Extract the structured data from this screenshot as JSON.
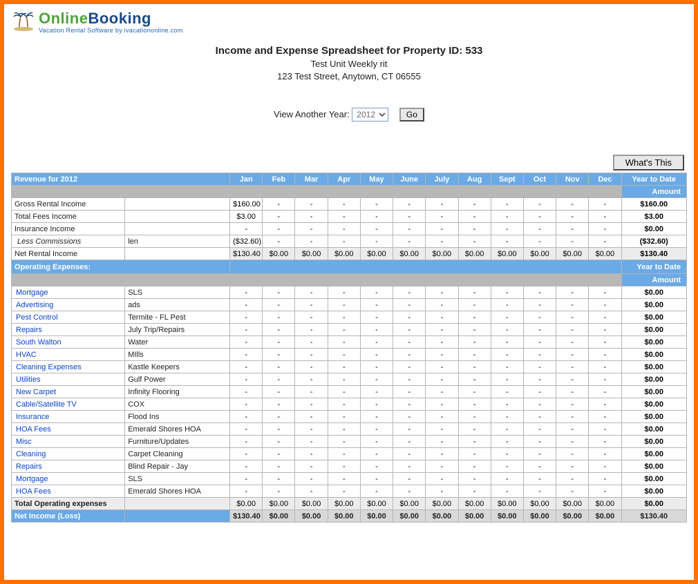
{
  "logo": {
    "line1a": "Online",
    "line1b": "Booking",
    "line2": "Vacation Rental Software by ivacationonline.com"
  },
  "header": {
    "title": "Income and Expense Spreadsheet for Property ID: 533",
    "unit": "Test Unit Weekly rit",
    "address": "123 Test Street, Anytown, CT 06555"
  },
  "controls": {
    "yearLabel": "View Another Year:",
    "yearValue": "2012",
    "go": "Go",
    "whatsThis": "What's This"
  },
  "months": [
    "Jan",
    "Feb",
    "Mar",
    "Apr",
    "May",
    "June",
    "July",
    "Aug",
    "Sept",
    "Oct",
    "Nov",
    "Dec"
  ],
  "ytdLabel": "Year to Date",
  "amountLabel": "Amount",
  "revenue": {
    "headerLabel": "Revenue for 2012",
    "rows": [
      {
        "label": "Gross Rental Income",
        "desc": "",
        "m": [
          "$160.00",
          "-",
          "-",
          "-",
          "-",
          "-",
          "-",
          "-",
          "-",
          "-",
          "-",
          "-"
        ],
        "ytd": "$160.00"
      },
      {
        "label": "Total Fees Income",
        "desc": "",
        "m": [
          "$3.00",
          "-",
          "-",
          "-",
          "-",
          "-",
          "-",
          "-",
          "-",
          "-",
          "-",
          "-"
        ],
        "ytd": "$3.00"
      },
      {
        "label": "Insurance Income",
        "desc": "",
        "m": [
          "-",
          "-",
          "-",
          "-",
          "-",
          "-",
          "-",
          "-",
          "-",
          "-",
          "-",
          "-"
        ],
        "ytd": "$0.00"
      },
      {
        "label": "Less Commissions",
        "desc": "len",
        "indent": true,
        "m": [
          "($32.60)",
          "-",
          "-",
          "-",
          "-",
          "-",
          "-",
          "-",
          "-",
          "-",
          "-",
          "-"
        ],
        "ytd": "($32.60)"
      }
    ],
    "net": {
      "label": "Net Rental Income",
      "m": [
        "$130.40",
        "$0.00",
        "$0.00",
        "$0.00",
        "$0.00",
        "$0.00",
        "$0.00",
        "$0.00",
        "$0.00",
        "$0.00",
        "$0.00",
        "$0.00"
      ],
      "ytd": "$130.40"
    }
  },
  "expenses": {
    "headerLabel": "Operating Expenses:",
    "rows": [
      {
        "label": "Mortgage",
        "desc": "SLS",
        "link": true,
        "m": [
          "-",
          "-",
          "-",
          "-",
          "-",
          "-",
          "-",
          "-",
          "-",
          "-",
          "-",
          "-"
        ],
        "ytd": "$0.00"
      },
      {
        "label": "Advertising",
        "desc": "ads",
        "link": true,
        "m": [
          "-",
          "-",
          "-",
          "-",
          "-",
          "-",
          "-",
          "-",
          "-",
          "-",
          "-",
          "-"
        ],
        "ytd": "$0.00"
      },
      {
        "label": "Pest Control",
        "desc": "Termite - FL Pest",
        "link": true,
        "m": [
          "-",
          "-",
          "-",
          "-",
          "-",
          "-",
          "-",
          "-",
          "-",
          "-",
          "-",
          "-"
        ],
        "ytd": "$0.00"
      },
      {
        "label": "Repairs",
        "desc": "July Trip/Repairs",
        "link": true,
        "m": [
          "-",
          "-",
          "-",
          "-",
          "-",
          "-",
          "-",
          "-",
          "-",
          "-",
          "-",
          "-"
        ],
        "ytd": "$0.00"
      },
      {
        "label": "South Walton",
        "desc": "Water",
        "link": true,
        "m": [
          "-",
          "-",
          "-",
          "-",
          "-",
          "-",
          "-",
          "-",
          "-",
          "-",
          "-",
          "-"
        ],
        "ytd": "$0.00"
      },
      {
        "label": "HVAC",
        "desc": "MIlls",
        "link": true,
        "m": [
          "-",
          "-",
          "-",
          "-",
          "-",
          "-",
          "-",
          "-",
          "-",
          "-",
          "-",
          "-"
        ],
        "ytd": "$0.00"
      },
      {
        "label": "Cleaning Expenses",
        "desc": "Kastle Keepers",
        "link": true,
        "m": [
          "-",
          "-",
          "-",
          "-",
          "-",
          "-",
          "-",
          "-",
          "-",
          "-",
          "-",
          "-"
        ],
        "ytd": "$0.00"
      },
      {
        "label": "Utilities",
        "desc": "Gulf Power",
        "link": true,
        "m": [
          "-",
          "-",
          "-",
          "-",
          "-",
          "-",
          "-",
          "-",
          "-",
          "-",
          "-",
          "-"
        ],
        "ytd": "$0.00"
      },
      {
        "label": "New Carpet",
        "desc": "Infinity Flooring",
        "link": true,
        "m": [
          "-",
          "-",
          "-",
          "-",
          "-",
          "-",
          "-",
          "-",
          "-",
          "-",
          "-",
          "-"
        ],
        "ytd": "$0.00"
      },
      {
        "label": "Cable/Satellite TV",
        "desc": "COX",
        "link": true,
        "m": [
          "-",
          "-",
          "-",
          "-",
          "-",
          "-",
          "-",
          "-",
          "-",
          "-",
          "-",
          "-"
        ],
        "ytd": "$0.00"
      },
      {
        "label": "Insurance",
        "desc": "Flood Ins",
        "link": true,
        "m": [
          "-",
          "-",
          "-",
          "-",
          "-",
          "-",
          "-",
          "-",
          "-",
          "-",
          "-",
          "-"
        ],
        "ytd": "$0.00"
      },
      {
        "label": "HOA Fees",
        "desc": "Emerald Shores HOA",
        "link": true,
        "m": [
          "-",
          "-",
          "-",
          "-",
          "-",
          "-",
          "-",
          "-",
          "-",
          "-",
          "-",
          "-"
        ],
        "ytd": "$0.00"
      },
      {
        "label": "Misc",
        "desc": "Furniture/Updates",
        "link": true,
        "m": [
          "-",
          "-",
          "-",
          "-",
          "-",
          "-",
          "-",
          "-",
          "-",
          "-",
          "-",
          "-"
        ],
        "ytd": "$0.00"
      },
      {
        "label": "Cleaning",
        "desc": "Carpet Cleaning",
        "link": true,
        "m": [
          "-",
          "-",
          "-",
          "-",
          "-",
          "-",
          "-",
          "-",
          "-",
          "-",
          "-",
          "-"
        ],
        "ytd": "$0.00"
      },
      {
        "label": "Repairs",
        "desc": "Blind Repair - Jay",
        "link": true,
        "m": [
          "-",
          "-",
          "-",
          "-",
          "-",
          "-",
          "-",
          "-",
          "-",
          "-",
          "-",
          "-"
        ],
        "ytd": "$0.00"
      },
      {
        "label": "Mortgage",
        "desc": "SLS",
        "link": true,
        "m": [
          "-",
          "-",
          "-",
          "-",
          "-",
          "-",
          "-",
          "-",
          "-",
          "-",
          "-",
          "-"
        ],
        "ytd": "$0.00"
      },
      {
        "label": "HOA Fees",
        "desc": "Emerald Shores HOA",
        "link": true,
        "m": [
          "-",
          "-",
          "-",
          "-",
          "-",
          "-",
          "-",
          "-",
          "-",
          "-",
          "-",
          "-"
        ],
        "ytd": "$0.00"
      }
    ],
    "total": {
      "label": "Total Operating expenses",
      "m": [
        "$0.00",
        "$0.00",
        "$0.00",
        "$0.00",
        "$0.00",
        "$0.00",
        "$0.00",
        "$0.00",
        "$0.00",
        "$0.00",
        "$0.00",
        "$0.00"
      ],
      "ytd": "$0.00"
    }
  },
  "netIncome": {
    "label": "Net Income (Loss)",
    "m": [
      "$130.40",
      "$0.00",
      "$0.00",
      "$0.00",
      "$0.00",
      "$0.00",
      "$0.00",
      "$0.00",
      "$0.00",
      "$0.00",
      "$0.00",
      "$0.00"
    ],
    "ytd": "$130.40"
  }
}
